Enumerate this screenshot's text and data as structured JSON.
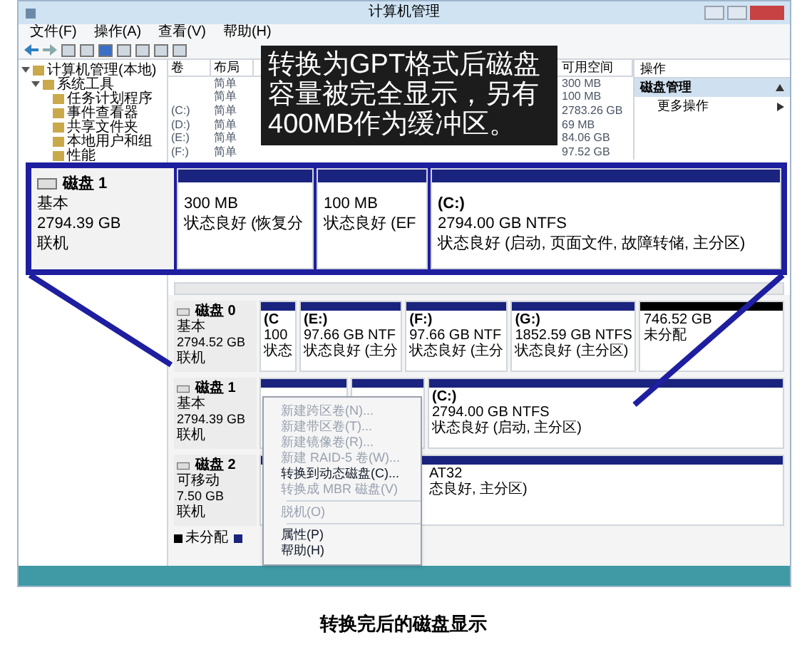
{
  "window": {
    "title": "计算机管理",
    "menu": [
      "文件(F)",
      "操作(A)",
      "查看(V)",
      "帮助(H)"
    ],
    "tree": [
      {
        "label": "计算机管理(本地)",
        "expanded": true,
        "children": [
          {
            "label": "系统工具",
            "expanded": true,
            "children": [
              {
                "label": "任务计划程序"
              },
              {
                "label": "事件查看器"
              },
              {
                "label": "共享文件夹"
              },
              {
                "label": "本地用户和组"
              },
              {
                "label": "性能"
              }
            ]
          }
        ]
      }
    ],
    "volume_list": {
      "columns": [
        "卷",
        "布局",
        "可用空间"
      ],
      "rows": [
        {
          "layout": "简单",
          "free_space": "300 MB"
        },
        {
          "layout": "简单",
          "free_space": "100 MB"
        },
        {
          "volume": "(C:)",
          "layout": "简单",
          "free_space": "2783.26 GB"
        },
        {
          "volume": "(D:)",
          "layout": "简单",
          "free_space": "69 MB"
        },
        {
          "volume": "(E:)",
          "layout": "简单",
          "free_space": "84.06 GB"
        },
        {
          "volume": "(F:)",
          "layout": "简单",
          "free_space": "97.52 GB"
        }
      ]
    },
    "actions": {
      "header": "操作",
      "items": [
        {
          "label": "磁盘管理",
          "selected": true,
          "kind": "section"
        },
        {
          "label": "更多操作",
          "selected": false,
          "kind": "submenu"
        }
      ]
    },
    "callout": [
      "转换为GPT格式后磁盘",
      "容量被完全显示，另有",
      "400MB作为缓冲区。"
    ],
    "zoomed_disk": {
      "name": "磁盘 1",
      "type": "基本",
      "size": "2794.39 GB",
      "status": "联机",
      "partitions": [
        {
          "size": "300 MB",
          "state": "状态良好 (恢复分",
          "kind": "primary"
        },
        {
          "size": "100 MB",
          "state": "状态良好 (EF",
          "kind": "primary"
        },
        {
          "label": "(C:)",
          "size": "2794.00 GB NTFS",
          "state": "状态良好 (启动, 页面文件, 故障转储, 主分区)",
          "kind": "primary"
        }
      ]
    },
    "disks": [
      {
        "name": "磁盘 0",
        "type": "基本",
        "size": "2794.52 GB",
        "status": "联机",
        "partitions": [
          {
            "label": "(C",
            "size": "100",
            "state": "状态",
            "kind": "primary"
          },
          {
            "label": "(E:)",
            "size": "97.66 GB NTF",
            "state": "状态良好 (主分",
            "kind": "primary"
          },
          {
            "label": "(F:)",
            "size": "97.66 GB NTF",
            "state": "状态良好 (主分",
            "kind": "primary"
          },
          {
            "label": "(G:)",
            "size": "1852.59 GB NTFS",
            "state": "状态良好 (主分区)",
            "kind": "primary"
          },
          {
            "size": "746.52 GB",
            "state": "未分配",
            "kind": "unallocated"
          }
        ]
      },
      {
        "name": "磁盘 1",
        "type": "基本",
        "size": "2794.39 GB",
        "status": "联机",
        "partitions": [
          {
            "kind": "primary"
          },
          {
            "kind": "primary"
          },
          {
            "label": "(C:)",
            "size": "2794.00 GB NTFS",
            "state": "状态良好 (启动, 主分区)",
            "kind": "primary"
          }
        ]
      },
      {
        "name": "磁盘 2",
        "type": "可移动",
        "size": "7.50 GB",
        "status": "联机",
        "partitions": [
          {
            "size": "AT32",
            "state": "态良好, 主分区)",
            "kind": "primary"
          }
        ]
      }
    ],
    "legend": [
      {
        "label": "未分配",
        "color": "#000000"
      },
      {
        "color": "#1a237e"
      }
    ],
    "context_menu": [
      {
        "label": "新建跨区卷(N)...",
        "disabled": true
      },
      {
        "label": "新建带区卷(T)...",
        "disabled": true
      },
      {
        "label": "新建镜像卷(R)...",
        "disabled": true
      },
      {
        "label": "新建 RAID-5 卷(W)...",
        "disabled": true
      },
      {
        "label": "转换到动态磁盘(C)...",
        "disabled": false
      },
      {
        "label": "转换成 MBR 磁盘(V)",
        "disabled": true
      },
      {
        "label": "脱机(O)",
        "disabled": true
      },
      {
        "label": "属性(P)",
        "disabled": false
      },
      {
        "label": "帮助(H)",
        "disabled": false
      }
    ]
  },
  "caption": "转换完后的磁盘显示"
}
